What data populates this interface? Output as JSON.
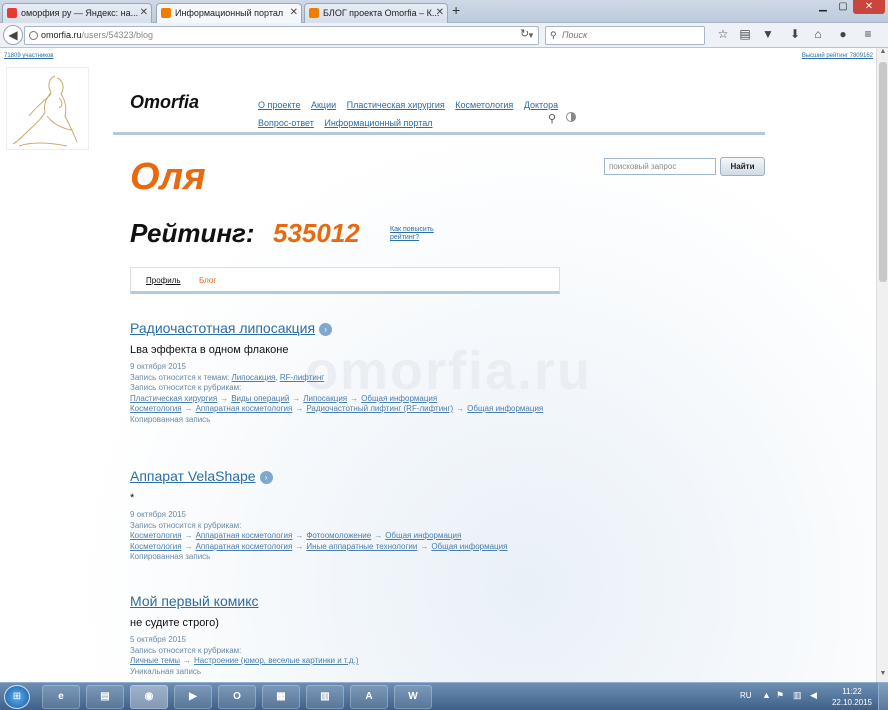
{
  "tabs": [
    {
      "title": "оморфия ру — Яндекс: на...",
      "favicon": "yandex-icon",
      "color": "#e63b2e"
    },
    {
      "title": "Информационный портал",
      "favicon": "omorfia-icon",
      "color": "#f07d00"
    },
    {
      "title": "БЛОГ проекта Omorfia – К...",
      "favicon": "omorfia-icon",
      "color": "#f07d00"
    }
  ],
  "url": {
    "host": "omorfia.ru",
    "path": "/users/54323/blog"
  },
  "search_placeholder": "Поиск",
  "page": {
    "participants": "71809 участников",
    "top_rating": "Высший рейтинг 7809162",
    "brand": "Omorfia",
    "nav": [
      "О проекте",
      "Акции",
      "Пластическая хирургия",
      "Косметология",
      "Доктора",
      "Вопрос-ответ",
      "Информационный портал"
    ],
    "site_search": {
      "placeholder": "поисковый запрос",
      "button": "Найти"
    },
    "user_name": "Оля",
    "rating_label": "Рейтинг:",
    "rating_value": "535012",
    "rating_help": "Как повысить рейтинг?",
    "profile_tabs": {
      "profile": "Профиль",
      "blog": "Блог"
    },
    "watermark": "omorfia.ru",
    "labels": {
      "topics": "Запись относится к темам:",
      "rubrics": "Запись относится к рубрикам:",
      "arrow": "→"
    },
    "posts": [
      {
        "title": "Радиочастотная липосакция",
        "subtitle": "Lва эффекта в одном флаконе",
        "date": "9 октября 2015",
        "topics": [
          "Липосакция",
          "RF-лифтинг"
        ],
        "rubric_rows": [
          [
            "Пластическая хирургия",
            "Виды операций",
            "Липосакция",
            "Общая информация"
          ],
          [
            "Косметология",
            "Аппаратная косметология",
            "Радиочастотный лифтинг (RF-лифтинг)",
            "Общая информация"
          ]
        ],
        "note": "Копированная запись"
      },
      {
        "title": "Аппарат VelaShape",
        "subtitle": "*",
        "date": "9 октября 2015",
        "topics": [],
        "rubric_rows": [
          [
            "Косметология",
            "Аппаратная косметология",
            "Фотоомоложение",
            "Общая информация"
          ],
          [
            "Косметология",
            "Аппаратная косметология",
            "Иные аппаратные технологии",
            "Общая информация"
          ]
        ],
        "note": "Копированная запись"
      },
      {
        "title": "Мой первый комикс",
        "subtitle": "не судите строго)",
        "date": "5 октября 2015",
        "topics": [],
        "rubric_rows": [
          [
            "Личные темы",
            "Настроение (юмор, веселые картинки и т.д.)"
          ]
        ],
        "note": "Уникальная запись"
      }
    ]
  },
  "taskbar": {
    "apps": [
      "ie-icon",
      "explorer-icon",
      "firefox-icon",
      "media-player-icon",
      "outlook-icon",
      "projects-icon",
      "pdf-icon",
      "vba-icon",
      "word-icon"
    ],
    "app_glyphs": [
      "e",
      "▤",
      "◉",
      "▶",
      "O",
      "▦",
      "▥",
      "A",
      "W"
    ],
    "lang": "RU",
    "time": "11:22",
    "date": "22.10.2015"
  },
  "colors": {
    "accent": "#e9690f",
    "link": "#2b6ea3"
  }
}
